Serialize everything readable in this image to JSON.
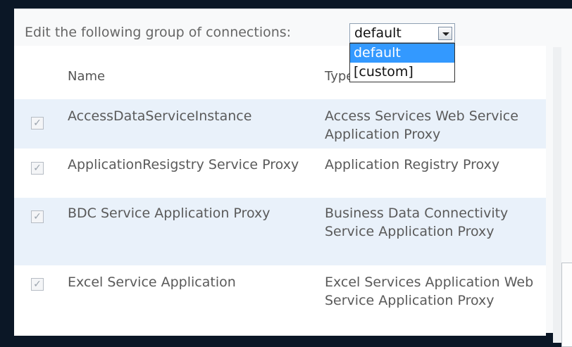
{
  "connections": {
    "label": "Edit the following group of connections:",
    "selected": "default",
    "options": [
      "default",
      "[custom]"
    ]
  },
  "table": {
    "columns": [
      "Name",
      "Type"
    ],
    "rows": [
      {
        "checked": true,
        "name": "AccessDataServiceInstance",
        "type": "Access Services Web Service Application Proxy"
      },
      {
        "checked": true,
        "name": "ApplicationResigstry Service Proxy",
        "type": "Application Registry Proxy"
      },
      {
        "checked": true,
        "name": "BDC Service Application Proxy",
        "type": "Business Data Connectivity Service Application Proxy"
      },
      {
        "checked": true,
        "name": "Excel Service Application",
        "type": "Excel Services Application Web Service Application Proxy"
      }
    ]
  },
  "colors": {
    "shaded_row": "#e9f1fa",
    "selected_option": "#3399ff",
    "background": "#0b1726"
  }
}
